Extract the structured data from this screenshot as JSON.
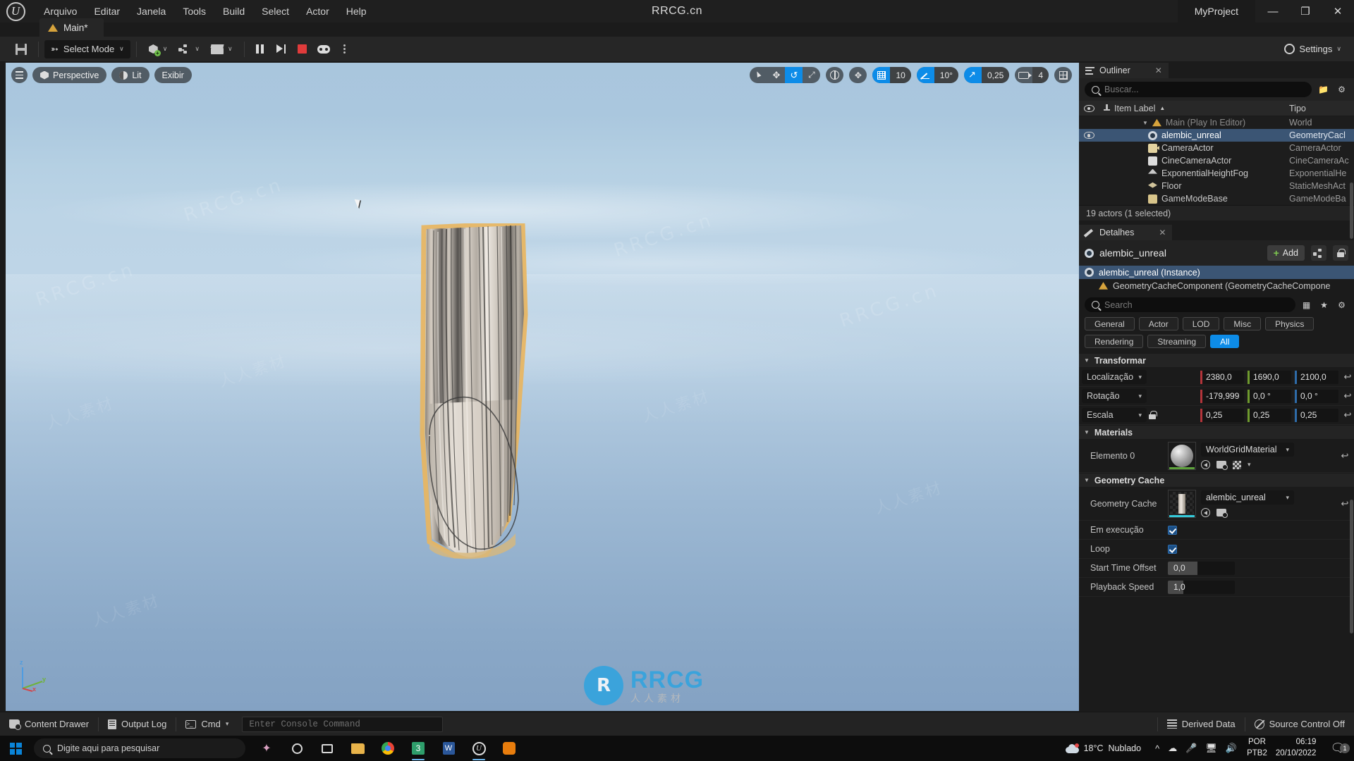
{
  "titlebar": {
    "menu": [
      "Arquivo",
      "Editar",
      "Janela",
      "Tools",
      "Build",
      "Select",
      "Actor",
      "Help"
    ],
    "center_title": "RRCG.cn",
    "project_name": "MyProject",
    "minimize": "—",
    "maximize": "❐",
    "close": "✕"
  },
  "level_tab": {
    "label": "Main*"
  },
  "toolbar": {
    "select_mode": "Select Mode",
    "settings": "Settings",
    "chevron": "∨"
  },
  "viewport": {
    "perspective": "Perspective",
    "lighting": "Lit",
    "show": "Exibir",
    "grid_snap_value": "10",
    "angle_snap_value": "10°",
    "scale_snap_value": "0,25",
    "camera_speed_value": "4",
    "axis_z": "z",
    "axis_y": "y",
    "axis_x": "x",
    "watermarks": [
      "RRCG.cn",
      "人人素材",
      "RRCG.cn",
      "人人素材",
      "RRCG.cn",
      "人人素材",
      "RRCG.cn",
      "人人素材"
    ],
    "brand": {
      "mark": "R",
      "line1": "RRCG",
      "line2": "人人素材"
    }
  },
  "outliner": {
    "tab_label": "Outliner",
    "close": "✕",
    "search_placeholder": "Buscar...",
    "columns": {
      "item_label": "Item Label",
      "sort_arrow": "▲",
      "type": "Tipo"
    },
    "rows": [
      {
        "label": "Main (Play In Editor)",
        "type": "World",
        "icon": "world-icon",
        "indent": 1,
        "caret": "▼",
        "selected": false,
        "dim": true,
        "eye": false
      },
      {
        "label": "alembic_unreal",
        "type": "GeometryCacl",
        "icon": "geometry-cache-icon",
        "indent": 2,
        "caret": "",
        "selected": true,
        "dim": false,
        "eye": true
      },
      {
        "label": "CameraActor",
        "type": "CameraActor",
        "icon": "camera-actor-icon",
        "indent": 2,
        "caret": "",
        "selected": false,
        "dim": false,
        "eye": false
      },
      {
        "label": "CineCameraActor",
        "type": "CineCameraAc",
        "icon": "cine-camera-icon",
        "indent": 2,
        "caret": "",
        "selected": false,
        "dim": false,
        "eye": false
      },
      {
        "label": "ExponentialHeightFog",
        "type": "ExponentialHe",
        "icon": "fog-icon",
        "indent": 2,
        "caret": "",
        "selected": false,
        "dim": false,
        "eye": false
      },
      {
        "label": "Floor",
        "type": "StaticMeshAct",
        "icon": "floor-icon",
        "indent": 2,
        "caret": "",
        "selected": false,
        "dim": false,
        "eye": false
      },
      {
        "label": "GameModeBase",
        "type": "GameModeBa",
        "icon": "gamemode-icon",
        "indent": 2,
        "caret": "",
        "selected": false,
        "dim": false,
        "eye": false
      }
    ],
    "status": "19 actors (1 selected)"
  },
  "details": {
    "tab_label": "Detalhes",
    "close": "✕",
    "actor_name": "alembic_unreal",
    "add_label": "Add",
    "components": [
      {
        "label": "alembic_unreal (Instance)",
        "selected": true,
        "sub": false
      },
      {
        "label": "GeometryCacheComponent (GeometryCacheCompone",
        "selected": false,
        "sub": true
      }
    ],
    "search_placeholder": "Search",
    "filters": [
      {
        "label": "General",
        "active": false
      },
      {
        "label": "Actor",
        "active": false
      },
      {
        "label": "LOD",
        "active": false
      },
      {
        "label": "Misc",
        "active": false
      },
      {
        "label": "Physics",
        "active": false
      },
      {
        "label": "Rendering",
        "active": false
      },
      {
        "label": "Streaming",
        "active": false
      },
      {
        "label": "All",
        "active": true
      }
    ],
    "transform": {
      "section": "Transformar",
      "location": {
        "label": "Localização",
        "x": "2380,0",
        "y": "1690,0",
        "z": "2100,0"
      },
      "rotation": {
        "label": "Rotação",
        "x": "-179,999",
        "y": "0,0 °",
        "z": "0,0 °"
      },
      "scale": {
        "label": "Escala",
        "x": "0,25",
        "y": "0,25",
        "z": "0,25"
      },
      "reset": "↩"
    },
    "materials": {
      "section": "Materials",
      "element_label": "Elemento 0",
      "material_name": "WorldGridMaterial"
    },
    "geometry_cache": {
      "section": "Geometry Cache",
      "field_label": "Geometry Cache",
      "asset_name": "alembic_unreal",
      "running_label": "Em execução",
      "running_checked": true,
      "loop_label": "Loop",
      "loop_checked": true,
      "start_time_offset_label": "Start Time Offset",
      "start_time_offset_value": "0,0",
      "playback_speed_label": "Playback Speed",
      "playback_speed_value": "1,0"
    }
  },
  "statusbar": {
    "content_drawer": "Content Drawer",
    "output_log": "Output Log",
    "cmd": "Cmd",
    "console_placeholder": "Enter Console Command",
    "derived_data": "Derived Data",
    "source_control": "Source Control Off"
  },
  "taskbar": {
    "search_placeholder": "Digite aqui para pesquisar",
    "weather_temp": "18°C",
    "weather_desc": "Nublado",
    "lang_line1": "POR",
    "lang_line2": "PTB2",
    "time": "06:19",
    "date": "20/10/2022",
    "notification_count": "1"
  },
  "colors": {
    "accent_blue": "#0d8ce8",
    "selection_blue": "#3b5574",
    "panel_bg": "#1b1b1b",
    "toolbar_bg": "#262626",
    "axis_x": "#b3343a",
    "axis_y": "#6f9a2e",
    "axis_z": "#2e6ba8",
    "stop_red": "#e03b3b",
    "green_plus": "#7ec94f"
  }
}
